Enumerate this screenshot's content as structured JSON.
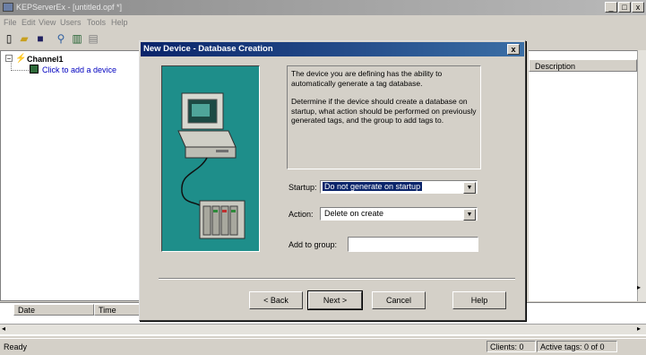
{
  "window": {
    "title": "KEPServerEx - [untitled.opf *]",
    "minimize": "_",
    "maximize": "□",
    "close": "x"
  },
  "menu": [
    "File",
    "Edit",
    "View",
    "Users",
    "Tools",
    "Help"
  ],
  "tree": {
    "channel": "Channel1",
    "add_device": "Click to add a device"
  },
  "right_pane": {
    "column": "Description"
  },
  "log": {
    "columns": [
      "Date",
      "Time"
    ]
  },
  "status": {
    "ready": "Ready",
    "clients": "Clients:  0",
    "active_tags": "Active tags:  0 of 0"
  },
  "dialog": {
    "title": "New Device - Database Creation",
    "close": "x",
    "desc1": "The device you are defining has the ability to automatically generate a tag database.",
    "desc2": "Determine if the device should create a database on startup, what action should be performed on previously generated tags, and the group to add tags to.",
    "startup_label": "Startup:",
    "startup_value": "Do not generate on startup",
    "action_label": "Action:",
    "action_value": "Delete on create",
    "group_label": "Add to group:",
    "group_value": "",
    "buttons": {
      "back": "< Back",
      "next": "Next >",
      "cancel": "Cancel",
      "help": "Help"
    }
  }
}
